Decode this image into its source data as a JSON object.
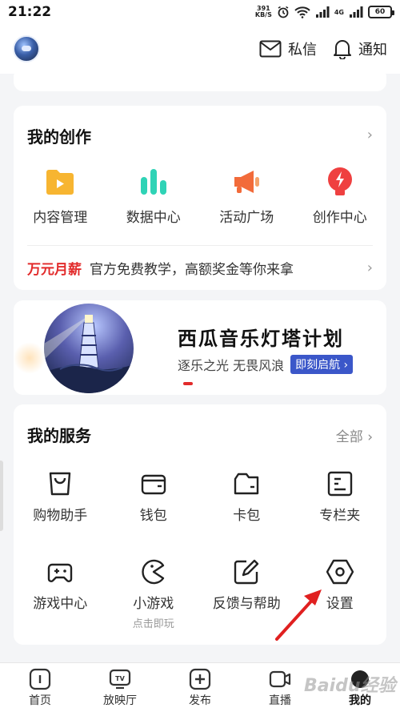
{
  "status_bar": {
    "time": "21:22",
    "net_speed_value": "391",
    "net_speed_unit": "KB/S",
    "network_label": "4G",
    "battery": "60"
  },
  "header": {
    "messages_label": "私信",
    "notifications_label": "通知"
  },
  "creation": {
    "title": "我的创作",
    "items": [
      {
        "label": "内容管理",
        "icon": "content-folder-icon"
      },
      {
        "label": "数据中心",
        "icon": "bar-chart-icon"
      },
      {
        "label": "活动广场",
        "icon": "megaphone-icon"
      },
      {
        "label": "创作中心",
        "icon": "lightning-bulb-icon"
      }
    ],
    "promo_tag": "万元月薪",
    "promo_text": "官方免费教学，高额奖金等你来拿"
  },
  "banner": {
    "title": "西瓜音乐灯塔计划",
    "subtitle": "逐乐之光 无畏风浪",
    "button": "即刻启航"
  },
  "services": {
    "title": "我的服务",
    "all_label": "全部",
    "items": [
      {
        "label": "购物助手",
        "sub": "",
        "icon": "shopping-bag-icon"
      },
      {
        "label": "钱包",
        "sub": "",
        "icon": "wallet-icon"
      },
      {
        "label": "卡包",
        "sub": "",
        "icon": "card-wallet-icon"
      },
      {
        "label": "专栏夹",
        "sub": "",
        "icon": "column-folder-icon"
      },
      {
        "label": "游戏中心",
        "sub": "",
        "icon": "gamepad-icon"
      },
      {
        "label": "小游戏",
        "sub": "点击即玩",
        "icon": "pacman-icon"
      },
      {
        "label": "反馈与帮助",
        "sub": "",
        "icon": "edit-feedback-icon"
      },
      {
        "label": "设置",
        "sub": "",
        "icon": "settings-hexagon-icon"
      }
    ]
  },
  "tabs": [
    {
      "label": "首页",
      "icon": "home-icon"
    },
    {
      "label": "放映厅",
      "icon": "tv-icon"
    },
    {
      "label": "发布",
      "icon": "plus-square-icon"
    },
    {
      "label": "直播",
      "icon": "camera-icon"
    },
    {
      "label": "我的",
      "icon": "profile-dot-icon"
    }
  ],
  "colors": {
    "accent_red": "#e22b2b",
    "banner_button": "#3b57c9",
    "folder_yellow": "#f7b531",
    "chart_teal": "#2fd3b6"
  },
  "watermark": "Baidu经验"
}
